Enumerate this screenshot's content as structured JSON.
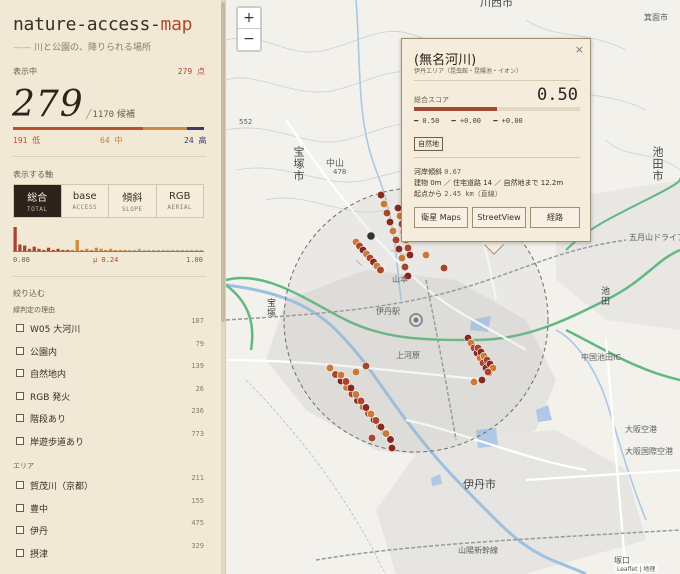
{
  "app": {
    "title_main": "nature-access-",
    "title_accent": "map",
    "subtitle_dash": "——",
    "subtitle": "川と公園の、降りられる場所"
  },
  "summary": {
    "label": "表示中",
    "count_right": "279 点",
    "big_number": "279",
    "slash": "╱",
    "total": "1170",
    "total_suffix": "候補",
    "low": "191 低",
    "mid": "64 中",
    "high": "24 高"
  },
  "axis": {
    "label": "表示する軸",
    "tabs": [
      {
        "label": "総合",
        "sub": "TOTAL",
        "active": true
      },
      {
        "label": "base",
        "sub": "ACCESS",
        "active": false
      },
      {
        "label": "傾斜",
        "sub": "SLOPE",
        "active": false
      },
      {
        "label": "RGB",
        "sub": "AERIAL",
        "active": false
      }
    ],
    "hist_min": "0.00",
    "hist_mean": "μ 0.24",
    "hist_max": "1.00",
    "hist_values": [
      22,
      6,
      5,
      2,
      4,
      2,
      1,
      3,
      1,
      2,
      1,
      1,
      1,
      10,
      1,
      2,
      1,
      3,
      2,
      1,
      2,
      1,
      1,
      1,
      1,
      1,
      2,
      1,
      1,
      1,
      1,
      1,
      1,
      1,
      1,
      1,
      1,
      1,
      1,
      1
    ]
  },
  "filters": {
    "label": "絞り込む",
    "reason_label": "緑判定の理由",
    "reasons": [
      {
        "label": "W05 大河川",
        "count": "187"
      },
      {
        "label": "公園内",
        "count": "79"
      },
      {
        "label": "自然地内",
        "count": "139"
      },
      {
        "label": "RGB 発火",
        "count": "26"
      },
      {
        "label": "階段あり",
        "count": "236"
      },
      {
        "label": "岸遊歩道あり",
        "count": "773"
      }
    ],
    "area_label": "エリア",
    "areas": [
      {
        "label": "賀茂川（京都）",
        "count": "211"
      },
      {
        "label": "豊中",
        "count": "155"
      },
      {
        "label": "伊丹",
        "count": "475"
      },
      {
        "label": "摂津",
        "count": "329"
      }
    ]
  },
  "map": {
    "zoom_in": "+",
    "zoom_out": "−",
    "labels": {
      "takarazuka_v": "宝塚市",
      "takarazuka_v2": "宝塚",
      "itami": "伊丹市",
      "ikeda_v": "池田市",
      "ikeda2_v": "池田",
      "kawanishi": "川西市",
      "nakayama": "中山",
      "elev478": "478",
      "elev552": "552",
      "yamamoto": "山本",
      "kamikawara": "上河原",
      "station_itami": "伊丹駅",
      "chugoku": "中国池田IC",
      "gojo": "五月山ドライブ",
      "osaka_kuko": "大阪空港",
      "osaka_kokusai": "大阪国際空港",
      "sanyo": "山陽新幹線",
      "minoo": "箕面市",
      "tsukaguchi": "塚口"
    },
    "attribution": "Leaflet | 地理"
  },
  "popup": {
    "title": "(無名河川)",
    "close": "×",
    "area": "伊丹エリア（昆虫館・昆陽池・イオン）",
    "score_label": "総合スコア",
    "score": "0.50",
    "score_fraction": 0.5,
    "deltas": [
      "━ 0.50",
      "━ +0.00",
      "━ +0.00"
    ],
    "badge": "自然地",
    "info1_label": "河岸傾斜",
    "info1_value": "0.67",
    "info2": "建物 0m ／ 住宅道路 14 ／ 自然地まで 12.2m",
    "info3_label": "起点から",
    "info3_value": "2.45 km（直線）",
    "buttons": [
      "衛星 Maps",
      "StreetView",
      "経路"
    ]
  },
  "colors": {
    "accent": "#b04a2c",
    "low": "#b5532e",
    "mid": "#d08a3c",
    "high": "#3e3a6b",
    "dark": "#2d231a",
    "dot_dark": "#8a2a1f",
    "dot_light": "#c97a3a"
  }
}
